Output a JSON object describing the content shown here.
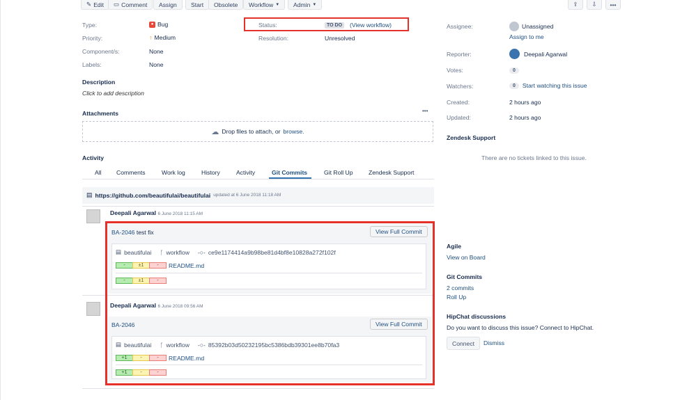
{
  "toolbar": {
    "edit": "Edit",
    "comment": "Comment",
    "assign": "Assign",
    "start": "Start",
    "obsolete": "Obsolete",
    "workflow": "Workflow",
    "admin": "Admin"
  },
  "details": {
    "type_label": "Type:",
    "type_value": "Bug",
    "priority_label": "Priority:",
    "priority_value": "Medium",
    "components_label": "Component/s:",
    "components_value": "None",
    "labels_label": "Labels:",
    "labels_value": "None",
    "status_label": "Status:",
    "status_value": "TO DO",
    "view_workflow": "(View workflow)",
    "resolution_label": "Resolution:",
    "resolution_value": "Unresolved"
  },
  "description": {
    "heading": "Description",
    "placeholder": "Click to add description"
  },
  "attachments": {
    "heading": "Attachments",
    "more": "•••",
    "drop_text": "Drop files to attach, or",
    "browse": "browse."
  },
  "activity": {
    "heading": "Activity",
    "tabs": [
      "All",
      "Comments",
      "Work log",
      "History",
      "Activity",
      "Git Commits",
      "Git Roll Up",
      "Zendesk Support"
    ],
    "active_tab": "Git Commits"
  },
  "repo": {
    "url": "https://github.com/beautifulai/beautifulai",
    "updated": "updated at 6 June 2018 11:18 AM"
  },
  "commits": [
    {
      "author": "Deepali Agarwal",
      "time": "6 June 2018 11:15 AM",
      "issue": "BA-2046",
      "message": "test fix",
      "view": "View Full Commit",
      "repo": "beautifulai",
      "branch": "workflow",
      "hash": "ce9e1174414a9b98be81d4bf8e10828a272f102f",
      "diff1": [
        "-",
        "±1",
        "-"
      ],
      "file": "README.md",
      "diff2": [
        "-",
        "±1",
        "-"
      ]
    },
    {
      "author": "Deepali Agarwal",
      "time": "6 June 2018 09:56 AM",
      "issue": "BA-2046",
      "message": "",
      "view": "View Full Commit",
      "repo": "beautifulai",
      "branch": "workflow",
      "hash": "85392b03d50232195bc5386bdb39301ee8b70fa3",
      "diff1": [
        "+1",
        "-",
        "-"
      ],
      "file": "README.md",
      "diff2": [
        "+1",
        "-",
        "-"
      ]
    }
  ],
  "people": {
    "assignee_label": "Assignee:",
    "assignee_value": "Unassigned",
    "assign_to_me": "Assign to me",
    "reporter_label": "Reporter:",
    "reporter_value": "Deepali Agarwal",
    "votes_label": "Votes:",
    "votes_value": "0",
    "watchers_label": "Watchers:",
    "watchers_value": "0",
    "start_watching": "Start watching this issue"
  },
  "dates": {
    "created_label": "Created:",
    "created_value": "2 hours ago",
    "updated_label": "Updated:",
    "updated_value": "2 hours ago"
  },
  "zendesk": {
    "heading": "Zendesk Support",
    "empty": "There are no tickets linked to this issue."
  },
  "agile": {
    "heading": "Agile",
    "link": "View on Board"
  },
  "git": {
    "heading": "Git Commits",
    "commits_link": "2 commits",
    "rollup_link": "Roll Up"
  },
  "hipchat": {
    "heading": "HipChat discussions",
    "text": "Do you want to discuss this issue? Connect to HipChat.",
    "connect": "Connect",
    "dismiss": "Dismiss"
  },
  "colors": {
    "highlight": "#e5312a",
    "link": "#205081",
    "bug": "#e5493a",
    "priority": "#f79232"
  },
  "icons": [
    "pencil-icon",
    "comment-icon",
    "chevron-down-icon",
    "share-icon",
    "export-icon",
    "more-icon",
    "bug-icon",
    "priority-arrow-icon",
    "upload-cloud-icon",
    "repo-icon",
    "branch-icon",
    "commit-icon",
    "file-icon",
    "avatar-icon"
  ]
}
